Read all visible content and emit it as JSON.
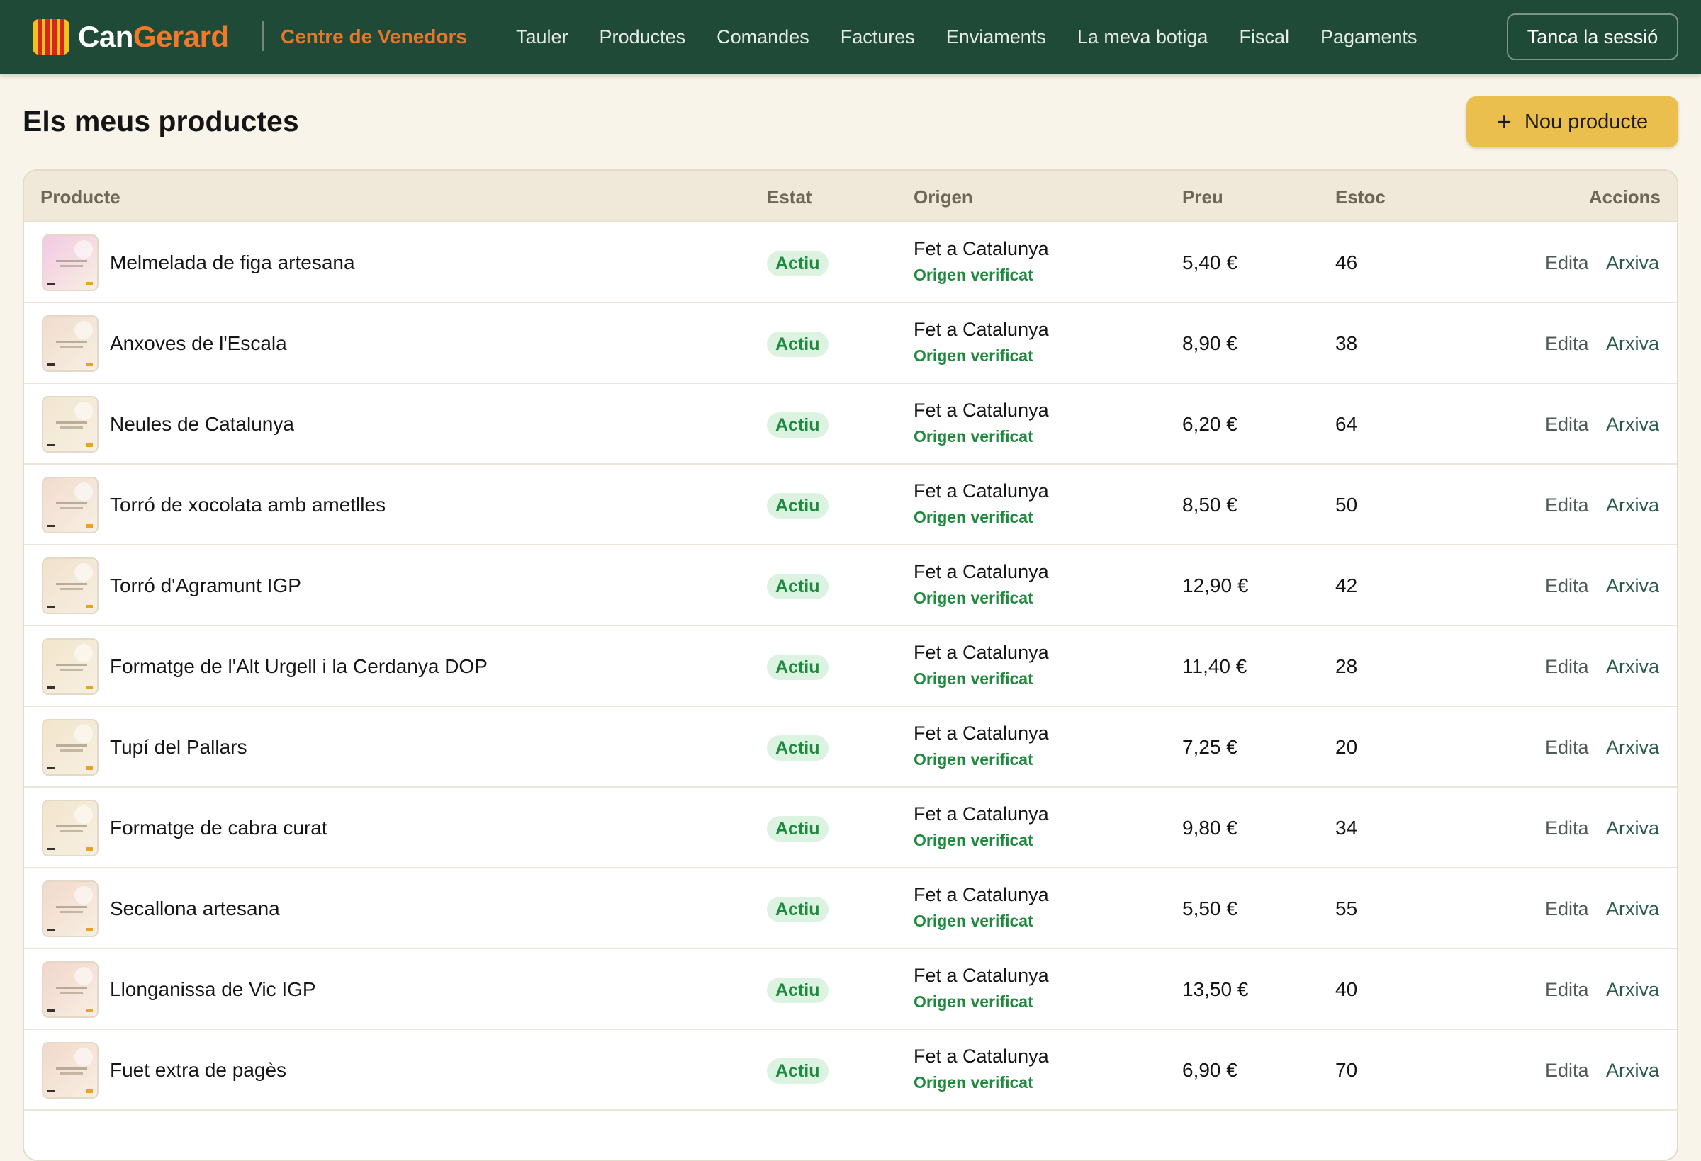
{
  "brand": {
    "part1": "Can",
    "part2": "Gerard",
    "section": "Centre de Venedors"
  },
  "nav": [
    "Tauler",
    "Productes",
    "Comandes",
    "Factures",
    "Enviaments",
    "La meva botiga",
    "Fiscal",
    "Pagaments"
  ],
  "logout_label": "Tanca la sessió",
  "page_title": "Els meus productes",
  "new_button": {
    "icon": "plus-icon",
    "label": "Nou producte"
  },
  "colors": {
    "topbar": "#1f4a37",
    "accent": "#e8772a",
    "button": "#eabf4e",
    "active": "#1d8a3e"
  },
  "table": {
    "columns": [
      "Producte",
      "Estat",
      "Origen",
      "Preu",
      "Estoc",
      "Accions"
    ],
    "rows": [
      {
        "name": "Melmelada de figa artesana",
        "status": "Actiu",
        "origin": "Fet a Catalunya",
        "verified": "Origen verificat",
        "price": "5,40 €",
        "stock": "46",
        "edit": "Edita",
        "archive": "Arxiva",
        "thumb_color": "#f2c9e4"
      },
      {
        "name": "Anxoves de l'Escala",
        "status": "Actiu",
        "origin": "Fet a Catalunya",
        "verified": "Origen verificat",
        "price": "8,90 €",
        "stock": "38",
        "edit": "Edita",
        "archive": "Arxiva",
        "thumb_color": "#f0dccd"
      },
      {
        "name": "Neules de Catalunya",
        "status": "Actiu",
        "origin": "Fet a Catalunya",
        "verified": "Origen verificat",
        "price": "6,20 €",
        "stock": "64",
        "edit": "Edita",
        "archive": "Arxiva",
        "thumb_color": "#f1e6d0"
      },
      {
        "name": "Torró de xocolata amb ametlles",
        "status": "Actiu",
        "origin": "Fet a Catalunya",
        "verified": "Origen verificat",
        "price": "8,50 €",
        "stock": "50",
        "edit": "Edita",
        "archive": "Arxiva",
        "thumb_color": "#f1dccf"
      },
      {
        "name": "Torró d'Agramunt IGP",
        "status": "Actiu",
        "origin": "Fet a Catalunya",
        "verified": "Origen verificat",
        "price": "12,90 €",
        "stock": "42",
        "edit": "Edita",
        "archive": "Arxiva",
        "thumb_color": "#f1e1cc"
      },
      {
        "name": "Formatge de l'Alt Urgell i la Cerdanya DOP",
        "status": "Actiu",
        "origin": "Fet a Catalunya",
        "verified": "Origen verificat",
        "price": "11,40 €",
        "stock": "28",
        "edit": "Edita",
        "archive": "Arxiva",
        "thumb_color": "#f1e6cc"
      },
      {
        "name": "Tupí del Pallars",
        "status": "Actiu",
        "origin": "Fet a Catalunya",
        "verified": "Origen verificat",
        "price": "7,25 €",
        "stock": "20",
        "edit": "Edita",
        "archive": "Arxiva",
        "thumb_color": "#f1e6cc"
      },
      {
        "name": "Formatge de cabra curat",
        "status": "Actiu",
        "origin": "Fet a Catalunya",
        "verified": "Origen verificat",
        "price": "9,80 €",
        "stock": "34",
        "edit": "Edita",
        "archive": "Arxiva",
        "thumb_color": "#f1e6cc"
      },
      {
        "name": "Secallona artesana",
        "status": "Actiu",
        "origin": "Fet a Catalunya",
        "verified": "Origen verificat",
        "price": "5,50 €",
        "stock": "55",
        "edit": "Edita",
        "archive": "Arxiva",
        "thumb_color": "#f1d9cc"
      },
      {
        "name": "Llonganissa de Vic IGP",
        "status": "Actiu",
        "origin": "Fet a Catalunya",
        "verified": "Origen verificat",
        "price": "13,50 €",
        "stock": "40",
        "edit": "Edita",
        "archive": "Arxiva",
        "thumb_color": "#f1d6cc"
      },
      {
        "name": "Fuet extra de pagès",
        "status": "Actiu",
        "origin": "Fet a Catalunya",
        "verified": "Origen verificat",
        "price": "6,90 €",
        "stock": "70",
        "edit": "Edita",
        "archive": "Arxiva",
        "thumb_color": "#f1d9cc"
      }
    ]
  }
}
